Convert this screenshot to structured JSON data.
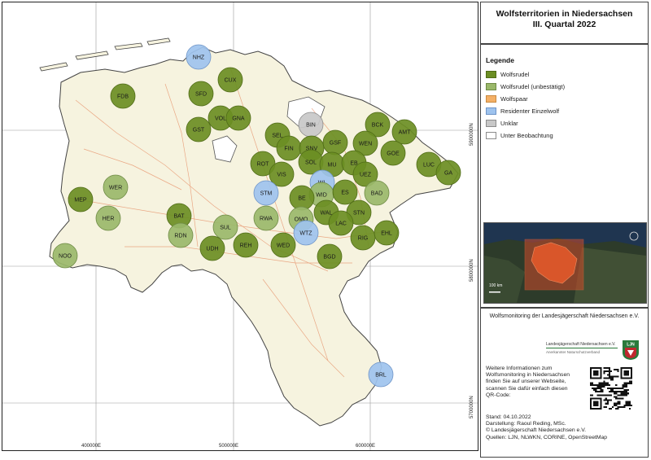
{
  "title": {
    "line1": "Wolfsterritorien in Niedersachsen",
    "line2": "III. Quartal 2022"
  },
  "legend": {
    "heading": "Legende",
    "items": [
      {
        "label": "Wolfsrudel",
        "color": "#6b8e23",
        "stroke": "#4f6b17"
      },
      {
        "label": "Wolfsrudel (unbestätigt)",
        "color": "#9ab86a",
        "stroke": "#6e8a45"
      },
      {
        "label": "Wolfspaar",
        "color": "#f4b066",
        "stroke": "#c98a40"
      },
      {
        "label": "Residenter Einzelwolf",
        "color": "#9ec3ee",
        "stroke": "#6e94c7"
      },
      {
        "label": "Unklar",
        "color": "#c8c8c8",
        "stroke": "#8c8c8c"
      },
      {
        "label": "Unter Beobachtung",
        "color": "#ffffff",
        "stroke": "#8c8c8c"
      }
    ]
  },
  "inset": {
    "scale_label": "100 km"
  },
  "info": {
    "monitoring": "Wolfsmonitoring der Landesjägerschaft Niedersachsen e.V.",
    "logo_name": "Landesjägerschaft Niedersachsen e.V.",
    "logo_sub": "Anerkannter Naturschutzverband",
    "logo_mark": "LJN",
    "more_info": [
      "Weitere Informationen zum",
      "Wolfsmonitoring in Niedersachsen",
      "finden Sie auf unserer Webseite,",
      "scannen Sie dafür einfach diesen",
      "QR-Code:"
    ],
    "credits": [
      "Stand: 04.10.2022",
      "Darstellung: Raoul Reding, MSc.",
      "© Landesjägerschaft Niedersachsen e.V.",
      "Quellen: LJN, NLWKN, CORINE, OpenStreetMap"
    ]
  },
  "axes": {
    "x_ticks": [
      "400000E",
      "500000E",
      "600000E"
    ],
    "y_ticks": [
      "5900000N",
      "5800000N",
      "5700000N"
    ]
  },
  "territories": [
    {
      "code": "NHZ",
      "type": "Residenter Einzelwolf"
    },
    {
      "code": "CUX",
      "type": "Wolfsrudel"
    },
    {
      "code": "SFD",
      "type": "Wolfsrudel"
    },
    {
      "code": "FDB",
      "type": "Wolfsrudel"
    },
    {
      "code": "VOL",
      "type": "Wolfsrudel"
    },
    {
      "code": "GNA",
      "type": "Wolfsrudel"
    },
    {
      "code": "GST",
      "type": "Wolfsrudel"
    },
    {
      "code": "BIN",
      "type": "Unklar"
    },
    {
      "code": "BCK",
      "type": "Wolfsrudel"
    },
    {
      "code": "AMT",
      "type": "Wolfsrudel"
    },
    {
      "code": "SEL",
      "type": "Wolfsrudel"
    },
    {
      "code": "FIN",
      "type": "Wolfsrudel"
    },
    {
      "code": "SNV",
      "type": "Wolfsrudel"
    },
    {
      "code": "GSF",
      "type": "Wolfsrudel"
    },
    {
      "code": "WEN",
      "type": "Wolfsrudel"
    },
    {
      "code": "GOE",
      "type": "Wolfsrudel"
    },
    {
      "code": "SOL",
      "type": "Wolfsrudel"
    },
    {
      "code": "MU",
      "type": "Wolfsrudel"
    },
    {
      "code": "EB",
      "type": "Wolfsrudel"
    },
    {
      "code": "LUC",
      "type": "Wolfsrudel"
    },
    {
      "code": "GA",
      "type": "Wolfsrudel"
    },
    {
      "code": "ROT",
      "type": "Wolfsrudel"
    },
    {
      "code": "VIS",
      "type": "Wolfsrudel"
    },
    {
      "code": "UEZ",
      "type": "Wolfsrudel"
    },
    {
      "code": "WL",
      "type": "Residenter Einzelwolf"
    },
    {
      "code": "WER",
      "type": "Wolfsrudel (unbestätigt)"
    },
    {
      "code": "STM",
      "type": "Residenter Einzelwolf"
    },
    {
      "code": "WID",
      "type": "Wolfsrudel (unbestätigt)"
    },
    {
      "code": "ES",
      "type": "Wolfsrudel"
    },
    {
      "code": "BAD",
      "type": "Wolfsrudel (unbestätigt)"
    },
    {
      "code": "MEP",
      "type": "Wolfsrudel"
    },
    {
      "code": "BE",
      "type": "Wolfsrudel"
    },
    {
      "code": "HER",
      "type": "Wolfsrudel (unbestätigt)"
    },
    {
      "code": "BAT",
      "type": "Wolfsrudel"
    },
    {
      "code": "RWA",
      "type": "Wolfsrudel (unbestätigt)"
    },
    {
      "code": "WAL",
      "type": "Wolfsrudel"
    },
    {
      "code": "STN",
      "type": "Wolfsrudel"
    },
    {
      "code": "OMO",
      "type": "Wolfsrudel (unbestätigt)"
    },
    {
      "code": "SUL",
      "type": "Wolfsrudel (unbestätigt)"
    },
    {
      "code": "LAC",
      "type": "Wolfsrudel"
    },
    {
      "code": "RDN",
      "type": "Wolfsrudel (unbestätigt)"
    },
    {
      "code": "WTZ",
      "type": "Residenter Einzelwolf"
    },
    {
      "code": "RIG",
      "type": "Wolfsrudel"
    },
    {
      "code": "EHL",
      "type": "Wolfsrudel"
    },
    {
      "code": "UDH",
      "type": "Wolfsrudel"
    },
    {
      "code": "REH",
      "type": "Wolfsrudel"
    },
    {
      "code": "WED",
      "type": "Wolfsrudel"
    },
    {
      "code": "NOO",
      "type": "Wolfsrudel (unbestätigt)"
    },
    {
      "code": "BGD",
      "type": "Wolfsrudel"
    },
    {
      "code": "BRL",
      "type": "Residenter Einzelwolf"
    }
  ]
}
